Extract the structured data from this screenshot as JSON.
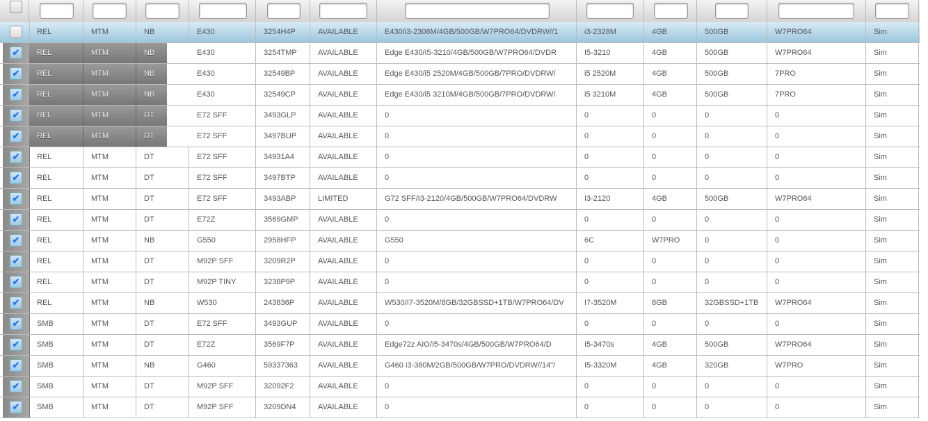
{
  "columns_count": 12,
  "rows": [
    {
      "checked": false,
      "selected": true,
      "cells": [
        "REL",
        "MTM",
        "NB",
        "E430",
        "3254H4P",
        "AVAILABLE",
        "E430/i3-2308M/4GB/500GB/W7PRO64/DVDRW//1",
        "i3-2328M",
        "4GB",
        "500GB",
        "W7PRO64",
        "Sim"
      ]
    },
    {
      "checked": true,
      "dark": true,
      "cells": [
        "REL",
        "MTM",
        "NB",
        "E430",
        "3254TMP",
        "AVAILABLE",
        "Edge E430/I5-3210/4GB/500GB/W7PRO64/DVDR",
        "I5-3210",
        "4GB",
        "500GB",
        "W7PRO64",
        "Sim"
      ]
    },
    {
      "checked": true,
      "dark": true,
      "cells": [
        "REL",
        "MTM",
        "NB",
        "E430",
        "32549BP",
        "AVAILABLE",
        "Edge E430/i5 2520M/4GB/500GB/7PRO/DVDRW/",
        "i5 2520M",
        "4GB",
        "500GB",
        "7PRO",
        "Sim"
      ]
    },
    {
      "checked": true,
      "dark": true,
      "cells": [
        "REL",
        "MTM",
        "NB",
        "E430",
        "32549CP",
        "AVAILABLE",
        "Edge E430/i5 3210M/4GB/500GB/7PRO/DVDRW/",
        "i5 3210M",
        "4GB",
        "500GB",
        "7PRO",
        "Sim"
      ]
    },
    {
      "checked": true,
      "dark": true,
      "cells": [
        "REL",
        "MTM",
        "DT",
        "E72 SFF",
        "3493GLP",
        "AVAILABLE",
        "0",
        "0",
        "0",
        "0",
        "0",
        "Sim"
      ]
    },
    {
      "checked": true,
      "dark": true,
      "cells": [
        "REL",
        "MTM",
        "DT",
        "E72 SFF",
        "3497BUP",
        "AVAILABLE",
        "0",
        "0",
        "0",
        "0",
        "0",
        "Sim"
      ]
    },
    {
      "checked": true,
      "cells": [
        "REL",
        "MTM",
        "DT",
        "E72 SFF",
        "34931A4",
        "AVAILABLE",
        "0",
        "0",
        "0",
        "0",
        "0",
        "Sim"
      ]
    },
    {
      "checked": true,
      "cells": [
        "REL",
        "MTM",
        "DT",
        "E72 SFF",
        "3497BTP",
        "AVAILABLE",
        "0",
        "0",
        "0",
        "0",
        "0",
        "Sim"
      ]
    },
    {
      "checked": true,
      "cells": [
        "REL",
        "MTM",
        "DT",
        "E72 SFF",
        "3493ABP",
        "LIMITED",
        "G72 SFF/I3-2120/4GB/500GB/W7PRO64/DVDRW",
        "I3-2120",
        "4GB",
        "500GB",
        "W7PRO64",
        "Sim"
      ]
    },
    {
      "checked": true,
      "cells": [
        "REL",
        "MTM",
        "DT",
        "E72Z",
        "3569GMP",
        "AVAILABLE",
        "0",
        "0",
        "0",
        "0",
        "0",
        "Sim"
      ]
    },
    {
      "checked": true,
      "cells": [
        "REL",
        "MTM",
        "NB",
        "G550",
        "2958HFP",
        "AVAILABLE",
        "G550",
        "6C",
        "W7PRO",
        "0",
        "0",
        "Sim"
      ]
    },
    {
      "checked": true,
      "cells": [
        "REL",
        "MTM",
        "DT",
        "M92P SFF",
        "3209R2P",
        "AVAILABLE",
        "0",
        "0",
        "0",
        "0",
        "0",
        "Sim"
      ]
    },
    {
      "checked": true,
      "cells": [
        "REL",
        "MTM",
        "DT",
        "M92P TINY",
        "3238P9P",
        "AVAILABLE",
        "0",
        "0",
        "0",
        "0",
        "0",
        "Sim"
      ]
    },
    {
      "checked": true,
      "cells": [
        "REL",
        "MTM",
        "NB",
        "W530",
        "243836P",
        "AVAILABLE",
        "W530/I7-3520M/8GB/32GBSSD+1TB/W7PRO64/DV",
        "I7-3520M",
        "8GB",
        "32GBSSD+1TB",
        "W7PRO64",
        "Sim"
      ]
    },
    {
      "checked": true,
      "cells": [
        "SMB",
        "MTM",
        "DT",
        "E72 SFF",
        "3493GUP",
        "AVAILABLE",
        "0",
        "0",
        "0",
        "0",
        "0",
        "Sim"
      ]
    },
    {
      "checked": true,
      "cells": [
        "SMB",
        "MTM",
        "DT",
        "E72Z",
        "3569F7P",
        "AVAILABLE",
        "Edge72z AIO/I5-3470s/4GB/500GB/W7PRO64/D",
        "I5-3470s",
        "4GB",
        "500GB",
        "W7PRO64",
        "Sim"
      ]
    },
    {
      "checked": true,
      "cells": [
        "SMB",
        "MTM",
        "NB",
        "G460",
        "59337363",
        "AVAILABLE",
        "G460 i3-380M/2GB/500GB/W7PRO/DVDRW//14\"/",
        "I5-3320M",
        "4GB",
        "320GB",
        "W7PRO",
        "Sim"
      ]
    },
    {
      "checked": true,
      "cells": [
        "SMB",
        "MTM",
        "DT",
        "M92P SFF",
        "32092F2",
        "AVAILABLE",
        "0",
        "0",
        "0",
        "0",
        "0",
        "Sim"
      ]
    },
    {
      "checked": true,
      "cells": [
        "SMB",
        "MTM",
        "DT",
        "M92P SFF",
        "3209DN4",
        "AVAILABLE",
        "0",
        "0",
        "0",
        "0",
        "0",
        "Sim"
      ]
    }
  ],
  "check_glyph": "✔"
}
